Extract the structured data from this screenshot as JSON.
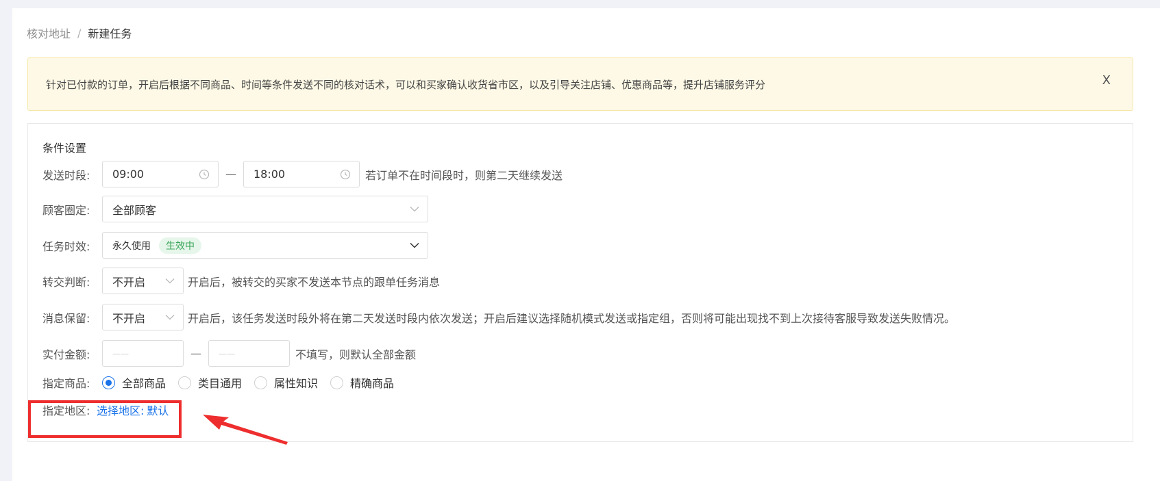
{
  "breadcrumb": {
    "parent": "核对地址",
    "separator": "/",
    "current": "新建任务"
  },
  "alert": {
    "text": "针对已付款的订单，开启后根据不同商品、时间等条件发送不同的核对话术，可以和买家确认收货省市区，以及引导关注店铺、优惠商品等，提升店铺服务评分",
    "close_label": "X"
  },
  "panel": {
    "title": "条件设置",
    "send_time": {
      "label": "发送时段:",
      "start": "09:00",
      "dash": "—",
      "end": "18:00",
      "hint": "若订单不在时间段时，则第二天继续发送"
    },
    "customer": {
      "label": "顾客圈定:",
      "value": "全部顾客"
    },
    "task_validity": {
      "label": "任务时效:",
      "value": "永久使用",
      "status": "生效中"
    },
    "transfer": {
      "label": "转交判断:",
      "value": "不开启",
      "hint": "开启后，被转交的买家不发送本节点的跟单任务消息"
    },
    "retain": {
      "label": "消息保留:",
      "value": "不开启",
      "hint": "开启后，该任务发送时段外将在第二天发送时段内依次发送；开启后建议选择随机模式发送或指定组，否则将可能出现找不到上次接待客服导致发送失败情况。"
    },
    "amount": {
      "label": "实付金额:",
      "min_placeholder": "——",
      "dash": "—",
      "max_placeholder": "——",
      "hint": "不填写，则默认全部金额"
    },
    "product": {
      "label": "指定商品:",
      "options": [
        {
          "label": "全部商品",
          "checked": true
        },
        {
          "label": "类目通用",
          "checked": false
        },
        {
          "label": "属性知识",
          "checked": false
        },
        {
          "label": "精确商品",
          "checked": false
        }
      ]
    },
    "region": {
      "label": "指定地区:",
      "link": "选择地区:",
      "value": "默认"
    }
  },
  "colors": {
    "primary": "#1a73e8",
    "success_tag_bg": "#e6f6ea",
    "success_tag_text": "#3aa55a",
    "alert_bg": "#fdf9e6",
    "annotation_red": "#ee2e2e"
  }
}
